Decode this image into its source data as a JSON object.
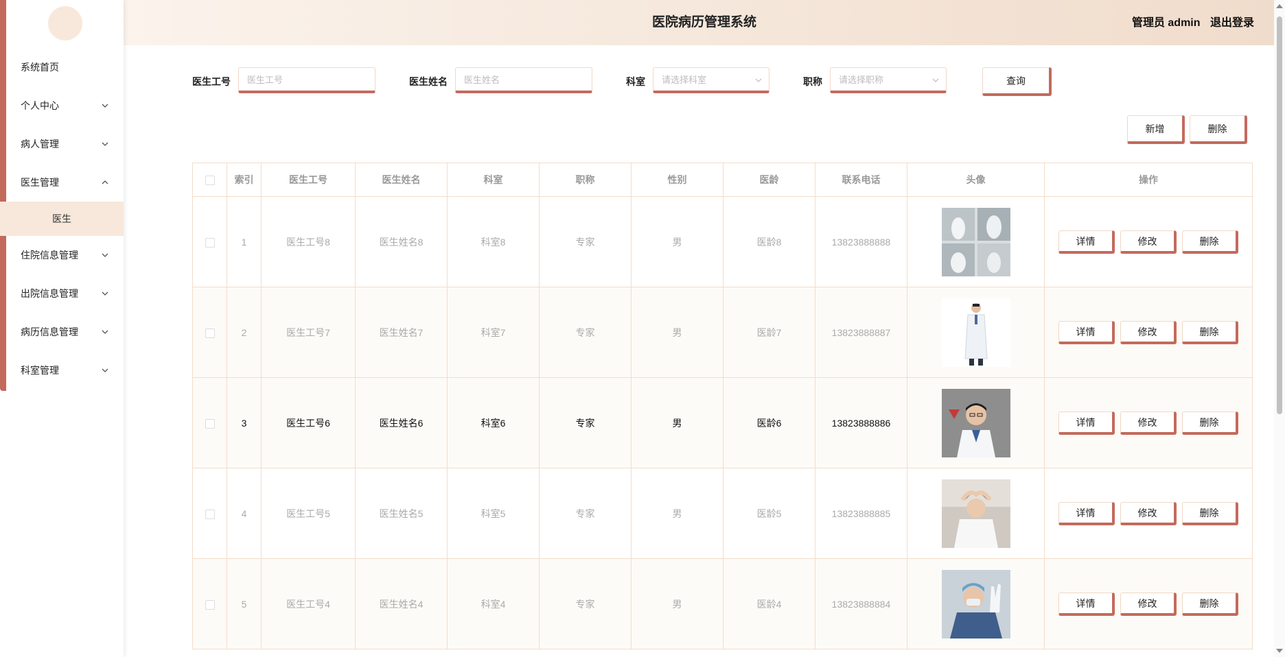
{
  "header": {
    "title": "医院病历管理系统",
    "user": "管理员 admin",
    "logout": "退出登录"
  },
  "sidebar": {
    "items": [
      {
        "label": "系统首页",
        "chevron": ""
      },
      {
        "label": "个人中心",
        "chevron": "down"
      },
      {
        "label": "病人管理",
        "chevron": "down"
      },
      {
        "label": "医生管理",
        "chevron": "up"
      },
      {
        "label": "住院信息管理",
        "chevron": "down"
      },
      {
        "label": "出院信息管理",
        "chevron": "down"
      },
      {
        "label": "病历信息管理",
        "chevron": "down"
      },
      {
        "label": "科室管理",
        "chevron": "down"
      }
    ],
    "sub_item": "医生"
  },
  "search": {
    "doc_no_label": "医生工号",
    "doc_no_placeholder": "医生工号",
    "doc_name_label": "医生姓名",
    "doc_name_placeholder": "医生姓名",
    "dept_label": "科室",
    "dept_placeholder": "请选择科室",
    "title_label": "职称",
    "title_placeholder": "请选择职称",
    "query_button": "查询"
  },
  "actions": {
    "add": "新增",
    "delete": "删除"
  },
  "table": {
    "headers": [
      "索引",
      "医生工号",
      "医生姓名",
      "科室",
      "职称",
      "性别",
      "医龄",
      "联系电话",
      "头像",
      "操作"
    ],
    "op_labels": {
      "detail": "详情",
      "edit": "修改",
      "delete": "删除"
    },
    "rows": [
      {
        "index": "1",
        "doc_no": "医生工号8",
        "doc_name": "医生姓名8",
        "dept": "科室8",
        "title": "专家",
        "gender": "男",
        "age": "医龄8",
        "phone": "13823888888",
        "avatar": "group-photo"
      },
      {
        "index": "2",
        "doc_no": "医生工号7",
        "doc_name": "医生姓名7",
        "dept": "科室7",
        "title": "专家",
        "gender": "男",
        "age": "医龄7",
        "phone": "13823888887",
        "avatar": "doctor-standing"
      },
      {
        "index": "3",
        "doc_no": "医生工号6",
        "doc_name": "医生姓名6",
        "dept": "科室6",
        "title": "专家",
        "gender": "男",
        "age": "医龄6",
        "phone": "13823888886",
        "avatar": "doctor-portrait"
      },
      {
        "index": "4",
        "doc_no": "医生工号5",
        "doc_name": "医生姓名5",
        "dept": "科室5",
        "title": "专家",
        "gender": "男",
        "age": "医龄5",
        "phone": "13823888885",
        "avatar": "doctor-heart"
      },
      {
        "index": "5",
        "doc_no": "医生工号4",
        "doc_name": "医生姓名4",
        "dept": "科室4",
        "title": "专家",
        "gender": "男",
        "age": "医龄4",
        "phone": "13823888884",
        "avatar": "surgeon"
      }
    ]
  },
  "colors": {
    "accent": "#c36a5d",
    "header_start": "#fbf3ec",
    "header_end": "#f0dccb",
    "submenu_bg": "#f8e8db",
    "border": "#f3dccb"
  }
}
